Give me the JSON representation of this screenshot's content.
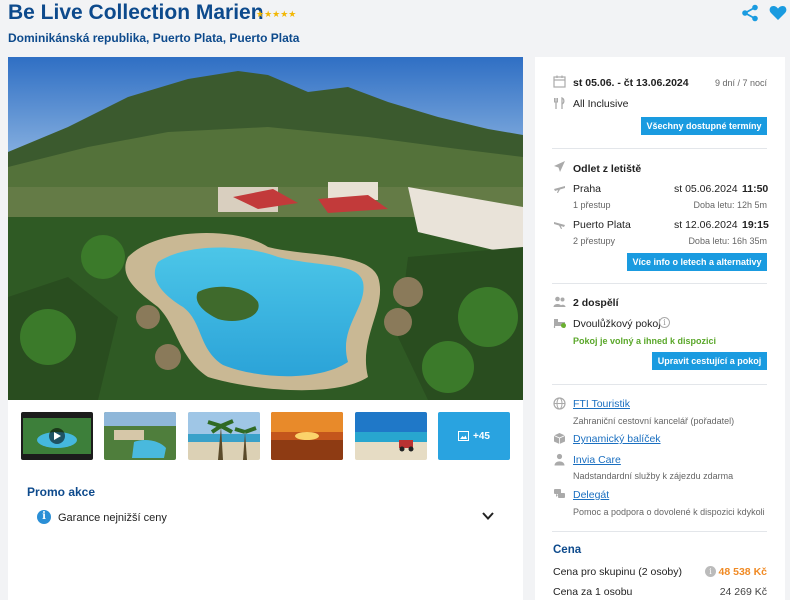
{
  "header": {
    "title": "Be Live Collection Marien",
    "stars": "★★★★★",
    "location": "Dominikánská republika, Puerto Plata, Puerto Plata"
  },
  "icons": [
    "share-icon",
    "heart-icon",
    "play-icon",
    "gallery-icon",
    "info-icon",
    "chevron-down-icon",
    "calendar-icon",
    "cutlery-icon",
    "plane-icon",
    "users-icon",
    "bed-icon",
    "globe-icon",
    "package-icon",
    "care-icon",
    "delegate-icon"
  ],
  "gallery": {
    "more_label": "+45"
  },
  "promo": {
    "title": "Promo akce",
    "guarantee": "Garance nejnižší ceny"
  },
  "term": {
    "dates": "st 05.06. - čt 13.06.2024",
    "duration": "9 dní / 7 nocí",
    "board": "All Inclusive",
    "all_terms_button": "Všechny dostupné termíny"
  },
  "flights": {
    "title": "Odlet z letiště",
    "outbound": {
      "city": "Praha",
      "date": "st 05.06.2024",
      "time": "11:50",
      "transfers": "1 přestup",
      "duration": "Doba letu: 12h 5m"
    },
    "inbound": {
      "city": "Puerto Plata",
      "date": "st 12.06.2024",
      "time": "19:15",
      "transfers": "2 přestupy",
      "duration": "Doba letu: 16h 35m"
    },
    "more_button": "Více info o letech a alternativy"
  },
  "travellers": {
    "adults": "2 dospělí",
    "room": "Dvoulůžkový pokoj",
    "availability": "Pokoj je volný a ihned k dispozici",
    "edit_button": "Upravit cestující a pokoj"
  },
  "provider": {
    "agency": "FTI Touristik",
    "agency_desc": "Zahraniční cestovní kancelář (pořadatel)",
    "package": "Dynamický balíček",
    "care": "Invia Care",
    "care_desc": "Nadstandardní služby k zájezdu zdarma",
    "delegate": "Delegát",
    "delegate_desc": "Pomoc a podpora o dovolené k dispozici kdykoli"
  },
  "price": {
    "title": "Cena",
    "group_label": "Cena pro skupinu (2 osoby)",
    "group_value": "48 538 Kč",
    "per_person_label": "Cena za 1 osobu",
    "per_person_value": "24 269 Kč"
  },
  "colors": {
    "brand_blue": "#0d4a8c",
    "button_blue": "#1a9be0",
    "price_orange": "#f08a24",
    "available_green": "#5aa72a",
    "star_yellow": "#f2b705"
  }
}
